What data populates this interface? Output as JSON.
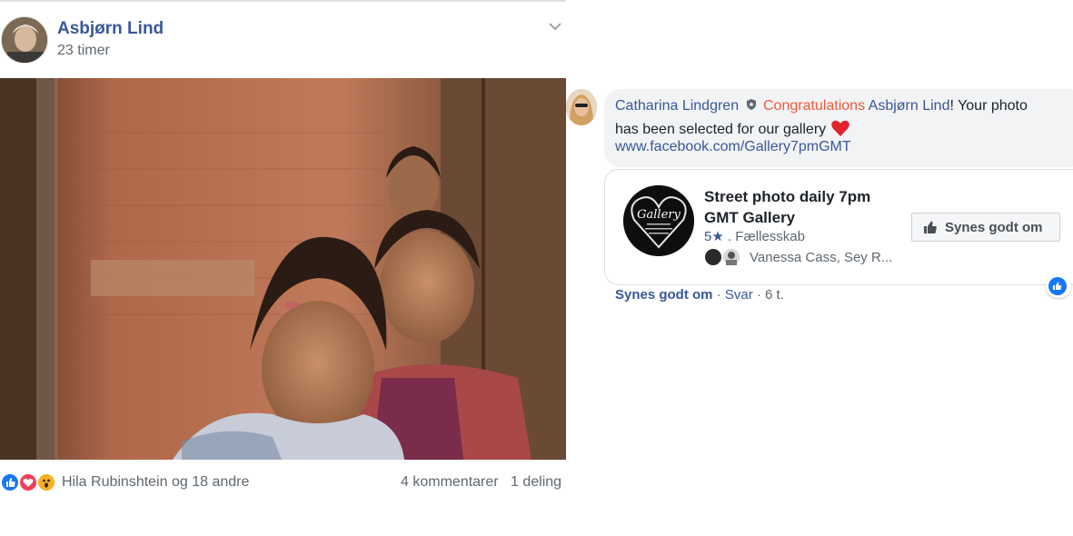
{
  "post": {
    "author": "Asbjørn Lind",
    "time": "23 timer",
    "reactions": {
      "text": "Hila Rubinshtein og 18 andre",
      "comments": "4 kommentarer",
      "shares": "1 deling",
      "icons": [
        "like-icon",
        "love-icon",
        "wow-icon"
      ]
    }
  },
  "comment": {
    "author": "Catharina Lindgren",
    "congrats": "Congratulations",
    "mention": "Asbjørn Lind",
    "text_after_mention": "! Your photo",
    "line2": "has been selected for our gallery",
    "link": "www.facebook.com/Gallery7pmGMT",
    "preview": {
      "title": "Street photo daily 7pm GMT Gallery",
      "rating": "5",
      "rating_star": "★",
      "category": ". Fællesskab",
      "friends": "Vanessa Cass, Sey R...",
      "like_button": "Synes godt om"
    },
    "actions": {
      "like": "Synes godt om",
      "sep1": " · ",
      "reply": "Svar",
      "sep2": " · ",
      "time": "6 t."
    }
  },
  "colors": {
    "link_blue": "#385898",
    "congrats_orange": "#f05a3c",
    "like_blue": "#1877f2",
    "love_red": "#f33e58",
    "wow_yellow": "#f7b125"
  }
}
